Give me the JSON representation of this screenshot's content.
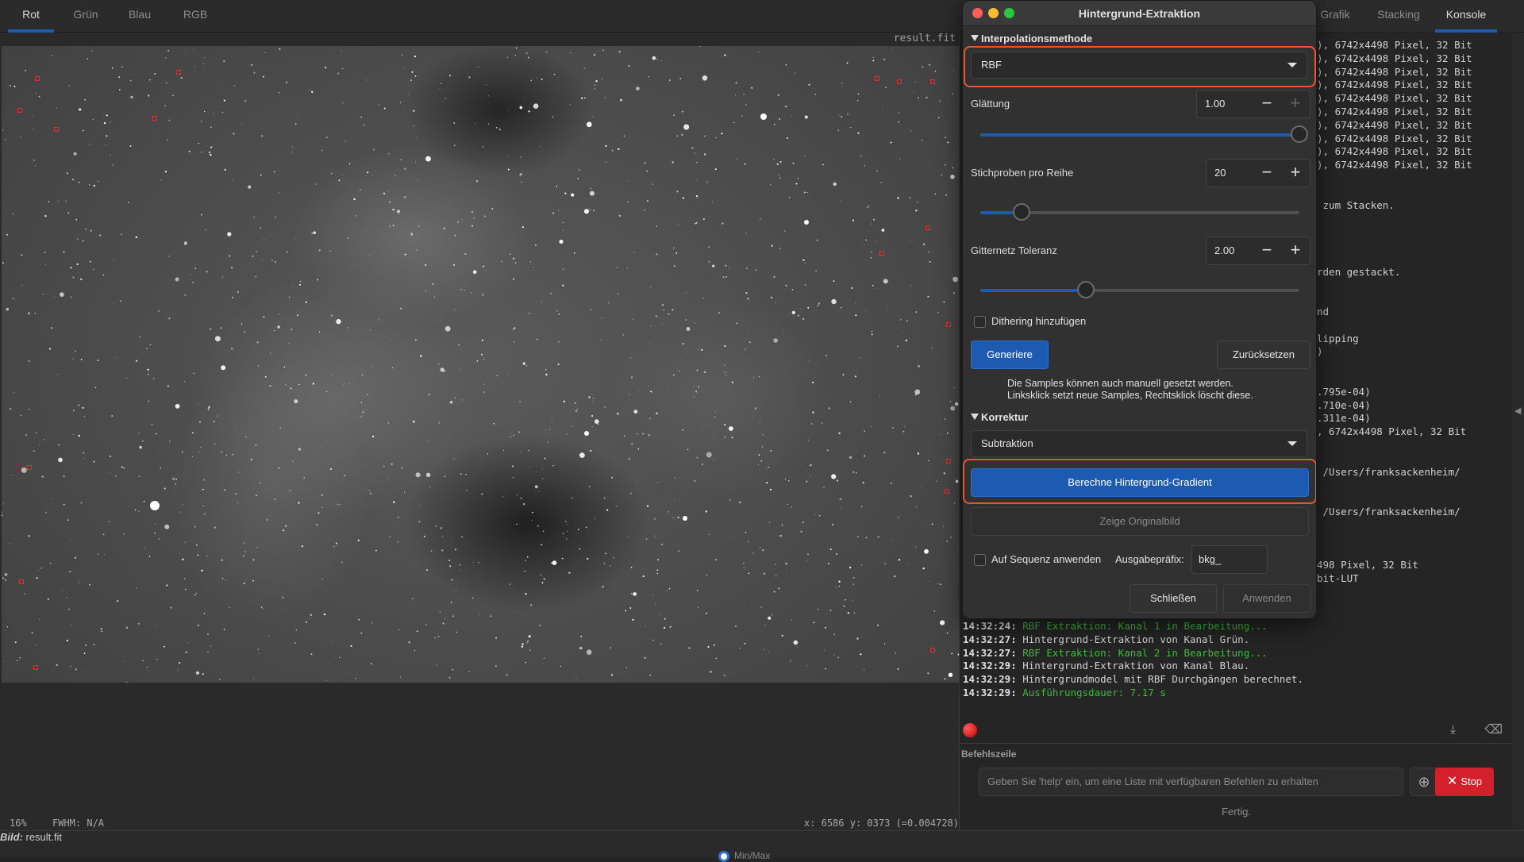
{
  "tabs": [
    "Rot",
    "Grün",
    "Blau",
    "RGB"
  ],
  "right_tabs": [
    "Grafik",
    "Stacking",
    "Konsole"
  ],
  "viewer": {
    "filename": "result.fit",
    "zoom": "16%",
    "fwhm": "FWHM: N/A",
    "coords": "x: 6586 y: 0373 (=0.004728)"
  },
  "bottom": {
    "bild_label": "Bild:",
    "bild_value": " result.fit",
    "minmax": "Min/Max"
  },
  "dialog": {
    "title": "Hintergrund-Extraktion",
    "interp_header": "Interpolationsmethode",
    "interp_value": "RBF",
    "smoothing_label": "Glättung",
    "smoothing_value": "1.00",
    "samples_label": "Stichproben pro Reihe",
    "samples_value": "20",
    "tolerance_label": "Gitternetz Toleranz",
    "tolerance_value": "2.00",
    "dither_label": "Dithering hinzufügen",
    "generate_btn": "Generiere",
    "reset_btn": "Zurücksetzen",
    "info_line1": "Die Samples können auch manuell gesetzt werden.",
    "info_line2": "Linksklick setzt neue Samples, Rechtsklick löscht diese.",
    "correction_header": "Korrektur",
    "correction_value": "Subtraktion",
    "compute_btn": "Berechne Hintergrund-Gradient",
    "show_orig_btn": "Zeige Originalbild",
    "sequence_label": "Auf Sequenz anwenden",
    "prefix_label": "Ausgabepräfix:",
    "prefix_value": "bkg_",
    "close_btn": "Schließen",
    "apply_btn": "Anwenden",
    "sliders": {
      "smoothing": 1.0,
      "samples_fraction": 0.13,
      "tolerance_fraction": 0.33
    }
  },
  "console": {
    "visible_right": [
      "), 6742x4498 Pixel, 32 Bit",
      "), 6742x4498 Pixel, 32 Bit",
      "), 6742x4498 Pixel, 32 Bit",
      "), 6742x4498 Pixel, 32 Bit",
      "), 6742x4498 Pixel, 32 Bit",
      "), 6742x4498 Pixel, 32 Bit",
      "), 6742x4498 Pixel, 32 Bit",
      "), 6742x4498 Pixel, 32 Bit",
      "), 6742x4498 Pixel, 32 Bit",
      "), 6742x4498 Pixel, 32 Bit",
      "",
      "",
      " zum Stacken.",
      "",
      "",
      "",
      "",
      "rden gestackt.",
      "",
      "",
      "nd",
      "",
      "lipping",
      ")",
      "",
      "",
      ".795e-04)",
      ".710e-04)",
      ".311e-04)",
      ", 6742x4498 Pixel, 32 Bit",
      "",
      "",
      " /Users/franksackenheim/",
      "",
      "",
      " /Users/franksackenheim/",
      "",
      "",
      "",
      "498 Pixel, 32 Bit",
      "bit-LUT"
    ],
    "log": [
      {
        "ts": "14:32:24:",
        "msg": " RBF Extraktion: Kanal 1 in Bearbeitung...",
        "green": true
      },
      {
        "ts": "14:32:27:",
        "msg": " Hintergrund-Extraktion von Kanal Grün.",
        "green": false
      },
      {
        "ts": "14:32:27:",
        "msg": " RBF Extraktion: Kanal 2 in Bearbeitung...",
        "green": true
      },
      {
        "ts": "14:32:29:",
        "msg": " Hintergrund-Extraktion von Kanal Blau.",
        "green": false
      },
      {
        "ts": "14:32:29:",
        "msg": " Hintergrundmodel mit RBF Durchgängen berechnet.",
        "green": false
      },
      {
        "ts": "14:32:29:",
        "msg": " Ausführungsdauer: 7.17 s",
        "green": true
      }
    ],
    "cmd_label": "Befehlszeile",
    "cmd_placeholder": "Geben Sie 'help' ein, um eine Liste mit verfügbaren Befehlen zu erhalten",
    "stop_label": "Stop",
    "status": "Fertig."
  },
  "colors": {
    "accent": "#1d5bb3",
    "highlight": "#e8552e",
    "stop": "#d3202a",
    "log_green": "#3dbb3d"
  }
}
